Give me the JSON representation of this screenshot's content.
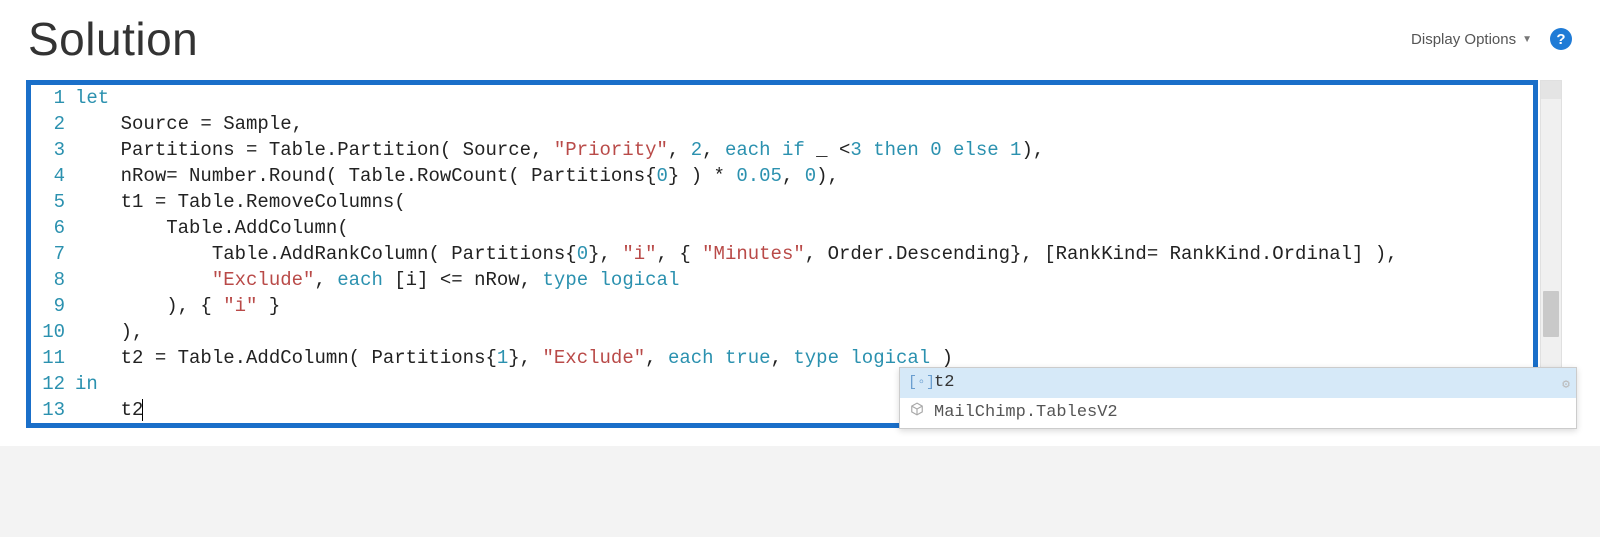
{
  "header": {
    "title": "Solution",
    "display_options_label": "Display Options",
    "help_tooltip": "?"
  },
  "editor": {
    "lines": [
      {
        "n": 1
      },
      {
        "n": 2
      },
      {
        "n": 3
      },
      {
        "n": 4
      },
      {
        "n": 5
      },
      {
        "n": 6
      },
      {
        "n": 7
      },
      {
        "n": 8
      },
      {
        "n": 9
      },
      {
        "n": 10
      },
      {
        "n": 11
      },
      {
        "n": 12
      },
      {
        "n": 13
      }
    ],
    "code": {
      "l1_kw": "let",
      "l2_a": "    Source = Sample,",
      "l3_a": "    Partitions = Table.Partition( Source, ",
      "l3_str": "\"Priority\"",
      "l3_b": ", ",
      "l3_num1": "2",
      "l3_c": ", ",
      "l3_each": "each",
      "l3_if": " if ",
      "l3_d": "_ <",
      "l3_num2": "3",
      "l3_then": " then ",
      "l3_num3": "0",
      "l3_else": " else ",
      "l3_num4": "1",
      "l3_e": "),",
      "l4_a": "    nRow= Number.Round( Table.RowCount( Partitions{",
      "l4_num0": "0",
      "l4_b": "} ) * ",
      "l4_num1": "0.05",
      "l4_c": ", ",
      "l4_num2": "0",
      "l4_d": "),",
      "l5_a": "    t1 = Table.RemoveColumns(",
      "l6_a": "        Table.AddColumn(",
      "l7_a": "            Table.AddRankColumn( Partitions{",
      "l7_num0": "0",
      "l7_b": "}, ",
      "l7_str1": "\"i\"",
      "l7_c": ", { ",
      "l7_str2": "\"Minutes\"",
      "l7_d": ", Order.Descending}, [RankKind= RankKind.Ordinal] ),",
      "l8_a": "            ",
      "l8_str": "\"Exclude\"",
      "l8_b": ", ",
      "l8_each": "each",
      "l8_c": " [i] <= nRow, ",
      "l8_type": "type",
      "l8_d": " ",
      "l8_logical": "logical",
      "l9_a": "        ), { ",
      "l9_str": "\"i\"",
      "l9_b": " }",
      "l10_a": "    ),",
      "l11_a": "    t2 = Table.AddColumn( Partitions{",
      "l11_num0": "1",
      "l11_b": "}, ",
      "l11_str": "\"Exclude\"",
      "l11_c": ", ",
      "l11_each": "each",
      "l11_d": " ",
      "l11_true": "true",
      "l11_e": ", ",
      "l11_type": "type",
      "l11_f": " ",
      "l11_logical": "logical",
      "l11_g": " )",
      "l12_kw": "in",
      "l13_a": "    t2"
    }
  },
  "autocomplete": {
    "items": [
      {
        "icon": "variable",
        "label": "t2",
        "selected": true
      },
      {
        "icon": "module",
        "label": "MailChimp.TablesV2",
        "selected": false
      }
    ]
  }
}
